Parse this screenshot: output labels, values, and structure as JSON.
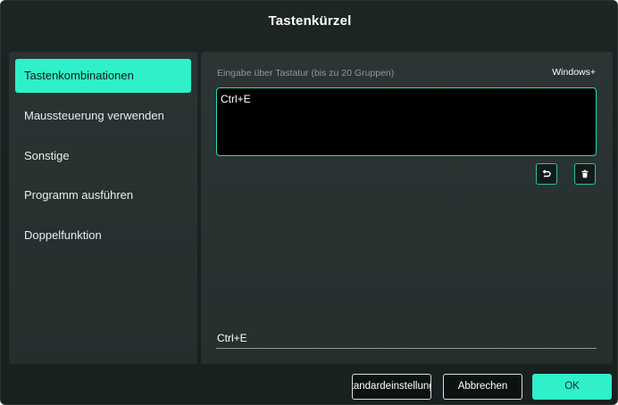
{
  "dialog": {
    "title": "Tastenkürzel"
  },
  "sidebar": {
    "items": [
      {
        "label": "Tastenkombinationen"
      },
      {
        "label": "Maussteuerung verwenden"
      },
      {
        "label": "Sonstige"
      },
      {
        "label": "Programm ausführen"
      },
      {
        "label": "Doppelfunktion"
      }
    ],
    "active_index": 0
  },
  "main": {
    "hint": "Eingabe über Tastatur (bis zu 20 Gruppen)",
    "mode": "Windows+",
    "keys_value": "Ctrl+E",
    "result": "Ctrl+E",
    "undo_icon": "undo-icon",
    "delete_icon": "trash-icon"
  },
  "footer": {
    "default_label": "Standardeinstellungen",
    "cancel_label": "Abbrechen",
    "ok_label": "OK"
  },
  "colors": {
    "accent": "#2ff0c9",
    "background": "#1a2221",
    "panel": "#2a3433"
  }
}
